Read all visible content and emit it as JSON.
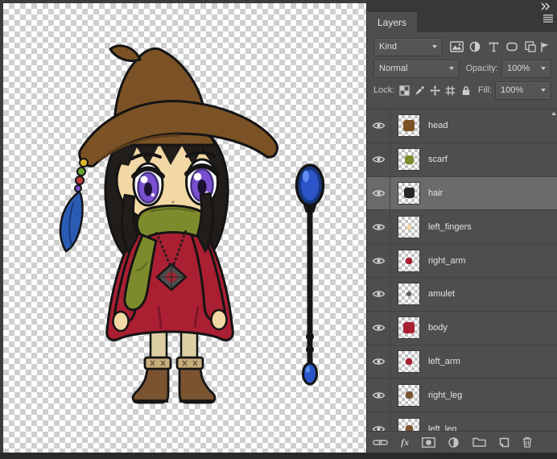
{
  "panel": {
    "tab_label": "Layers",
    "kind_label": "Kind",
    "blend_mode": "Normal",
    "opacity_label": "Opacity:",
    "opacity_value": "100%",
    "lock_label": "Lock:",
    "fill_label": "Fill:",
    "fill_value": "100%",
    "fx_label": "fx",
    "filter_icons": [
      "pixel-layer-filter",
      "adjustment-layer-filter",
      "type-layer-filter",
      "shape-layer-filter",
      "smart-object-filter",
      "filtering-toggle-flag"
    ],
    "lock_icons": [
      "lock-transparent-pixels",
      "lock-image-pixels",
      "lock-position",
      "lock-artboards",
      "lock-all"
    ],
    "footer_icons": [
      "link-layers",
      "layer-style-fx",
      "add-layer-mask",
      "new-adjustment-layer",
      "new-group",
      "new-layer",
      "delete-layer"
    ],
    "selected_row_color": "#6b6b6b",
    "layers": [
      {
        "name": "head",
        "visible": true,
        "selected": false,
        "thumb_color": "#7b5226",
        "thumb_scale": 1
      },
      {
        "name": "scarf",
        "visible": true,
        "selected": false,
        "thumb_color": "#7e8b2d",
        "thumb_scale": 0.75
      },
      {
        "name": "hair",
        "visible": true,
        "selected": true,
        "thumb_color": "#2a2624",
        "thumb_scale": 0.9
      },
      {
        "name": "left_fingers",
        "visible": true,
        "selected": false,
        "thumb_color": "#f2d8a4",
        "thumb_scale": 0.4
      },
      {
        "name": "right_arm",
        "visible": true,
        "selected": false,
        "thumb_color": "#aa1f32",
        "thumb_scale": 0.6
      },
      {
        "name": "amulet",
        "visible": true,
        "selected": false,
        "thumb_color": "#5a5a5a",
        "thumb_scale": 0.4
      },
      {
        "name": "body",
        "visible": true,
        "selected": false,
        "thumb_color": "#aa1f32",
        "thumb_scale": 1
      },
      {
        "name": "left_arm",
        "visible": true,
        "selected": false,
        "thumb_color": "#aa1f32",
        "thumb_scale": 0.6
      },
      {
        "name": "right_leg",
        "visible": true,
        "selected": false,
        "thumb_color": "#7a5331",
        "thumb_scale": 0.65
      },
      {
        "name": "left_leg",
        "visible": true,
        "selected": false,
        "thumb_color": "#7a5331",
        "thumb_scale": 0.65
      }
    ]
  },
  "canvas": {
    "content": "chibi witch character with drooping hat, beads and feather, red dress, green scarf, cube amulet, brown boots, and a blue-orb staff on transparent checkerboard",
    "transparency_checker": [
      "#ffffff",
      "#cfcfcf"
    ],
    "colors": {
      "hat": "#7b5226",
      "hatdark": "#5d3d1b",
      "band": "#8f902f",
      "hair": "#201d1b",
      "skin": "#f2d8a4",
      "iris": "#7a4fd0",
      "irisdark": "#46307e",
      "dress": "#aa1f32",
      "dressdark": "#771526",
      "scarf": "#7e8b2d",
      "scarfdark": "#5a651f",
      "sock": "#ded0a4",
      "boot": "#7a5331",
      "cuff": "#c7ad7c",
      "gem": "#a32430",
      "orb": "#2b55c8",
      "orbdark": "#17377e",
      "orbhi": "#5e8ff0",
      "feather": "#2b5cb4",
      "bead_yellow": "#e0b62c",
      "bead_green": "#69a42f",
      "bead_red": "#c04040",
      "bead_purple": "#7a4fd0"
    }
  }
}
